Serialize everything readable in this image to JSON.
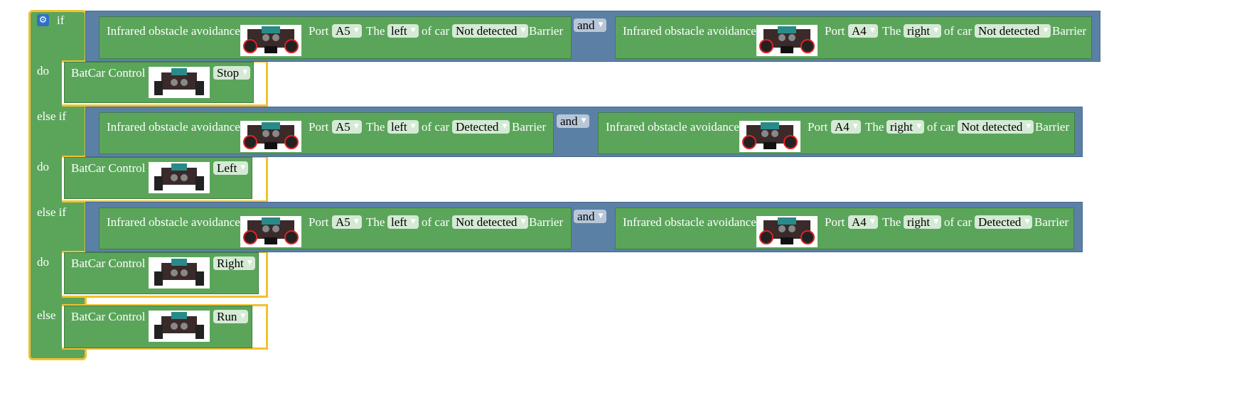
{
  "keywords": {
    "if": "if",
    "do": "do",
    "else_if": "else if",
    "else": "else"
  },
  "sensor": {
    "title": "Infrared obstacle avoidance",
    "port": "Port",
    "the": "The",
    "of_car": "of car",
    "barrier": "Barrier"
  },
  "conditions": [
    {
      "left": {
        "port": "A5",
        "side": "left",
        "state": "Not detected"
      },
      "op": "and",
      "right": {
        "port": "A4",
        "side": "right",
        "state": "Not detected"
      }
    },
    {
      "left": {
        "port": "A5",
        "side": "left",
        "state": "Detected"
      },
      "op": "and",
      "right": {
        "port": "A4",
        "side": "right",
        "state": "Not detected"
      }
    },
    {
      "left": {
        "port": "A5",
        "side": "left",
        "state": "Not detected"
      },
      "op": "and",
      "right": {
        "port": "A4",
        "side": "right",
        "state": "Detected"
      }
    }
  ],
  "actions": [
    {
      "title": "BatCar Control",
      "command": "Stop"
    },
    {
      "title": "BatCar Control",
      "command": "Left"
    },
    {
      "title": "BatCar Control",
      "command": "Right"
    },
    {
      "title": "BatCar Control",
      "command": "Run"
    }
  ],
  "icons": {
    "settings": "gear-icon",
    "dropdown": "dropdown-arrow-icon",
    "car_image": "batcar-robot-image"
  },
  "colors": {
    "logic_block": "#5b80a5",
    "sensor_block": "#5ba55b",
    "if_border": "#f2c12e",
    "field_bg": "#d5ead5"
  }
}
